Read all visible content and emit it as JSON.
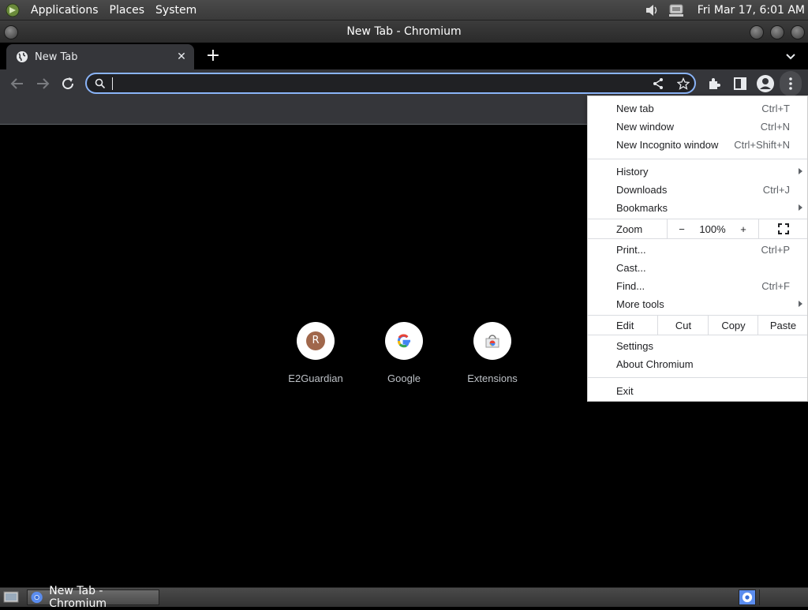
{
  "system_panel": {
    "menus": [
      "Applications",
      "Places",
      "System"
    ],
    "clock": "Fri Mar 17,  6:01 AM"
  },
  "window": {
    "title": "New Tab - Chromium"
  },
  "tab": {
    "title": "New Tab"
  },
  "omnibox": {
    "value": "",
    "placeholder": ""
  },
  "shortcuts": [
    {
      "label": "E2Guardian",
      "letter": "R"
    },
    {
      "label": "Google",
      "letter": "G"
    },
    {
      "label": "Extensions",
      "letter": ""
    }
  ],
  "app_menu": {
    "new_tab": {
      "label": "New tab",
      "shortcut": "Ctrl+T"
    },
    "new_window": {
      "label": "New window",
      "shortcut": "Ctrl+N"
    },
    "new_incognito": {
      "label": "New Incognito window",
      "shortcut": "Ctrl+Shift+N"
    },
    "history": {
      "label": "History"
    },
    "downloads": {
      "label": "Downloads",
      "shortcut": "Ctrl+J"
    },
    "bookmarks": {
      "label": "Bookmarks"
    },
    "zoom": {
      "label": "Zoom",
      "minus": "−",
      "level": "100%",
      "plus": "+"
    },
    "print": {
      "label": "Print...",
      "shortcut": "Ctrl+P"
    },
    "cast": {
      "label": "Cast..."
    },
    "find": {
      "label": "Find...",
      "shortcut": "Ctrl+F"
    },
    "more_tools": {
      "label": "More tools"
    },
    "edit": {
      "label": "Edit",
      "cut": "Cut",
      "copy": "Copy",
      "paste": "Paste"
    },
    "settings": {
      "label": "Settings"
    },
    "about": {
      "label": "About Chromium"
    },
    "exit": {
      "label": "Exit"
    }
  },
  "taskbar": {
    "task_label": "New Tab - Chromium"
  },
  "colors": {
    "accent": "#8ab4f8",
    "toolbar": "#35363a",
    "omnibox_bg": "#202124",
    "avatar_bg": "#a0674b"
  }
}
